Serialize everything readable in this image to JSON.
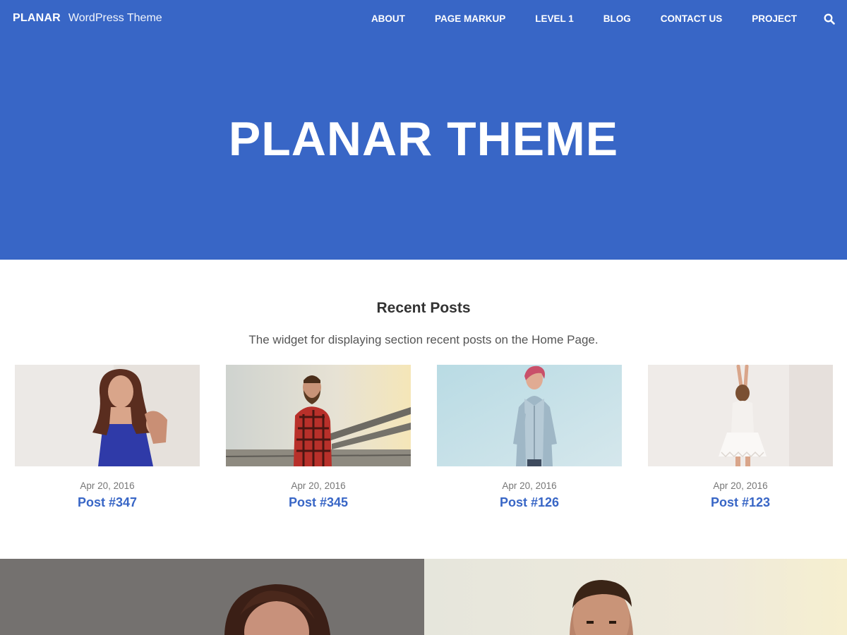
{
  "site": {
    "name": "PLANAR",
    "tagline": "WordPress Theme"
  },
  "nav": {
    "items": [
      {
        "label": "ABOUT"
      },
      {
        "label": "PAGE MARKUP"
      },
      {
        "label": "LEVEL 1"
      },
      {
        "label": "BLOG"
      },
      {
        "label": "CONTACT US"
      },
      {
        "label": "PROJECT"
      }
    ],
    "search_icon": "search-icon"
  },
  "hero": {
    "title": "PLANAR THEME"
  },
  "recent_posts": {
    "title": "Recent Posts",
    "description": "The widget for displaying section recent posts on the Home Page.",
    "posts": [
      {
        "date": "Apr 20, 2016",
        "title": "Post #347"
      },
      {
        "date": "Apr 20, 2016",
        "title": "Post #345"
      },
      {
        "date": "Apr 20, 2016",
        "title": "Post #126"
      },
      {
        "date": "Apr 20, 2016",
        "title": "Post #123"
      }
    ]
  },
  "colors": {
    "accent": "#3866c6",
    "header_bg": "#3866c6",
    "text": "#333333",
    "muted": "#777777"
  }
}
